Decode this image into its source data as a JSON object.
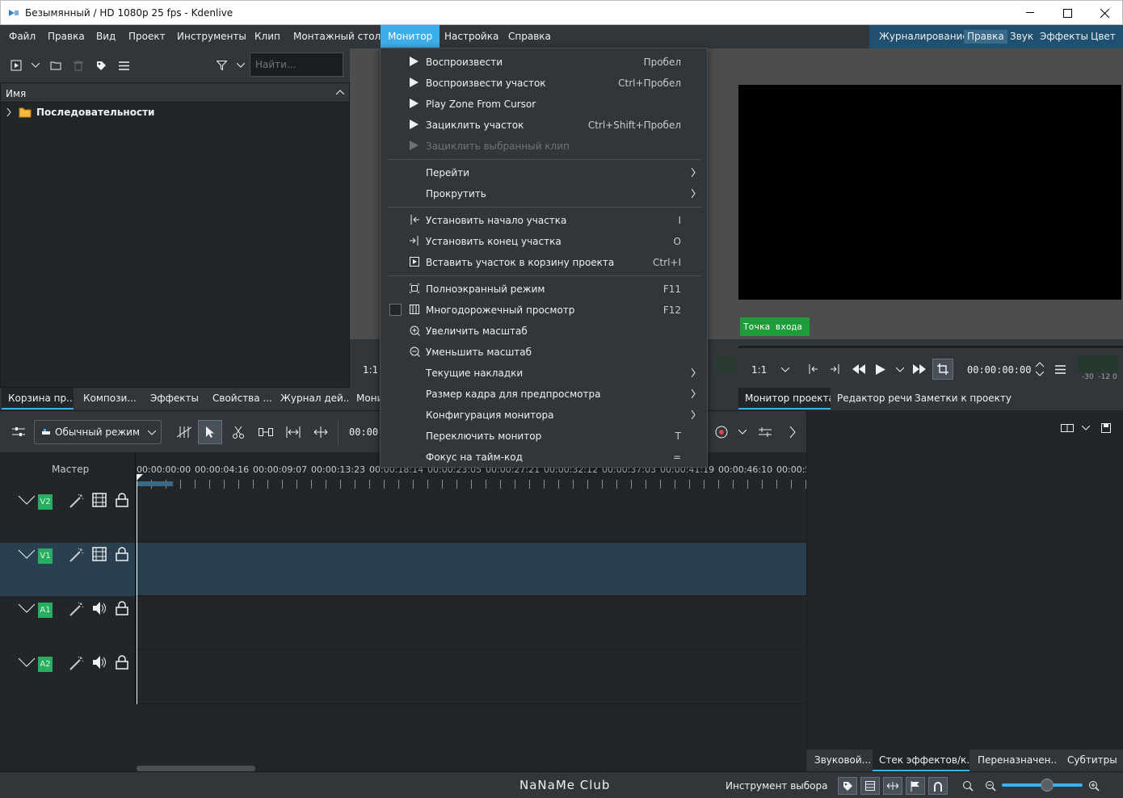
{
  "window": {
    "title": "Безымянный / HD 1080p 25 fps - Kdenlive"
  },
  "menubar": {
    "items": [
      "Файл",
      "Правка",
      "Вид",
      "Проект",
      "Инструменты",
      "Клип",
      "Монтажный стол",
      "Монитор",
      "Настройка",
      "Справка"
    ],
    "active": "Монитор"
  },
  "layouts": {
    "items": [
      "Журналирование",
      "Правка",
      "Звук",
      "Эффекты",
      "Цвет"
    ],
    "active": "Правка"
  },
  "bin": {
    "search_placeholder": "Найти...",
    "column_header": "Имя",
    "folder": "Последовательности",
    "tabs": [
      "Корзина пр...",
      "Компози...",
      "Эффекты",
      "Свойства ...",
      "Журнал дей...",
      "Мони"
    ]
  },
  "clip_monitor": {
    "zoom": "1:1"
  },
  "project_monitor": {
    "overlay": "Точка входа",
    "zoom": "1:1",
    "timecode": "00:00:00:00",
    "audio_scale": "-30  -12 0",
    "tabs": [
      "Монитор проекта",
      "Редактор речи",
      "Заметки к проекту"
    ]
  },
  "monitor_menu": {
    "items": [
      {
        "label": "Воспроизвести",
        "shortcut": "Пробел",
        "icon": "play-icon"
      },
      {
        "label": "Воспроизвести участок",
        "shortcut": "Ctrl+Пробел",
        "icon": "play-icon"
      },
      {
        "label": "Play Zone From Cursor",
        "shortcut": "",
        "icon": "play-icon"
      },
      {
        "label": "Зациклить участок",
        "shortcut": "Ctrl+Shift+Пробел",
        "icon": "play-icon"
      },
      {
        "label": "Зациклить выбранный клип",
        "shortcut": "",
        "icon": "play-icon",
        "disabled": true
      },
      {
        "label": "Перейти",
        "submenu": true
      },
      {
        "label": "Прокрутить",
        "submenu": true
      },
      {
        "label": "Установить начало участка",
        "shortcut": "I",
        "icon": "zone-in-icon"
      },
      {
        "label": "Установить конец участка",
        "shortcut": "O",
        "icon": "zone-out-icon"
      },
      {
        "label": "Вставить участок в корзину проекта",
        "shortcut": "Ctrl+I",
        "icon": "insert-icon"
      },
      {
        "label": "Полноэкранный режим",
        "shortcut": "F11",
        "icon": "fullscreen-icon"
      },
      {
        "label": "Многодорожечный просмотр",
        "shortcut": "F12",
        "icon": "multitrack-icon",
        "checkbox": true
      },
      {
        "label": "Увеличить масштаб",
        "shortcut": "",
        "icon": "zoom-in-icon"
      },
      {
        "label": "Уменьшить масштаб",
        "shortcut": "",
        "icon": "zoom-out-icon"
      },
      {
        "label": "Текущие накладки",
        "submenu": true
      },
      {
        "label": "Размер кадра для предпросмотра",
        "submenu": true
      },
      {
        "label": "Конфигурация монитора",
        "submenu": true
      },
      {
        "label": "Переключить монитор",
        "shortcut": "T"
      },
      {
        "label": "Фокус на тайм-код",
        "shortcut": "="
      }
    ]
  },
  "timeline": {
    "mode": "Обычный режим",
    "timecode": "00:00:",
    "master": "Мастер",
    "ruler": [
      "00:00:00:00",
      "00:00:04:16",
      "00:00:09:07",
      "00:00:13:23",
      "00:00:18:14",
      "00:00:23:05",
      "00:00:27:21",
      "00:00:32:12",
      "00:00:37:03",
      "00:00:41:19",
      "00:00:46:10",
      "00:00:5"
    ],
    "tracks": [
      "V2",
      "V1",
      "A1",
      "A2"
    ]
  },
  "effects_panel": {
    "tabs": [
      "Звуковой...",
      "Стек эффектов/к...",
      "Переназначен...",
      "Субтитры"
    ]
  },
  "statusbar": {
    "watermark": "NaNaMe Club",
    "tool": "Инструмент выбора"
  },
  "colors": {
    "accent": "#3daee9",
    "track_label": "#27ae60",
    "overlay": "#1f9d3a"
  }
}
